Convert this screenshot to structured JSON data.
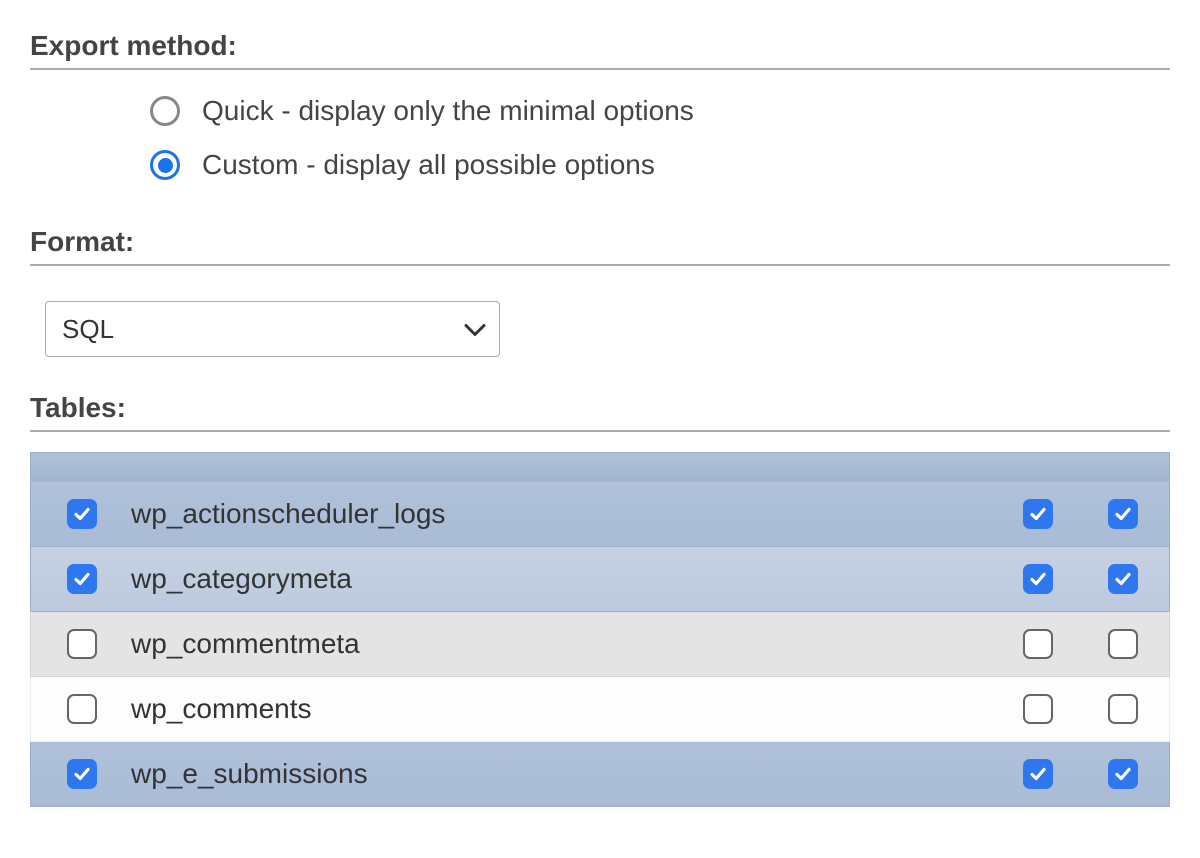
{
  "headings": {
    "export_method": "Export method:",
    "format": "Format:",
    "tables": "Tables:"
  },
  "export_method": {
    "options": [
      {
        "label": "Quick - display only the minimal options",
        "selected": false
      },
      {
        "label": "Custom - display all possible options",
        "selected": true
      }
    ]
  },
  "format": {
    "selected": "SQL"
  },
  "tables": {
    "rows": [
      {
        "name": "wp_actionscheduler_logs",
        "select": true,
        "structure": true,
        "data": true,
        "style": "selected-dark"
      },
      {
        "name": "wp_categorymeta",
        "select": true,
        "structure": true,
        "data": true,
        "style": "selected-light"
      },
      {
        "name": "wp_commentmeta",
        "select": false,
        "structure": false,
        "data": false,
        "style": "unselected-grey"
      },
      {
        "name": "wp_comments",
        "select": false,
        "structure": false,
        "data": false,
        "style": "unselected-white"
      },
      {
        "name": "wp_e_submissions",
        "select": true,
        "structure": true,
        "data": true,
        "style": "selected-dark"
      }
    ]
  }
}
